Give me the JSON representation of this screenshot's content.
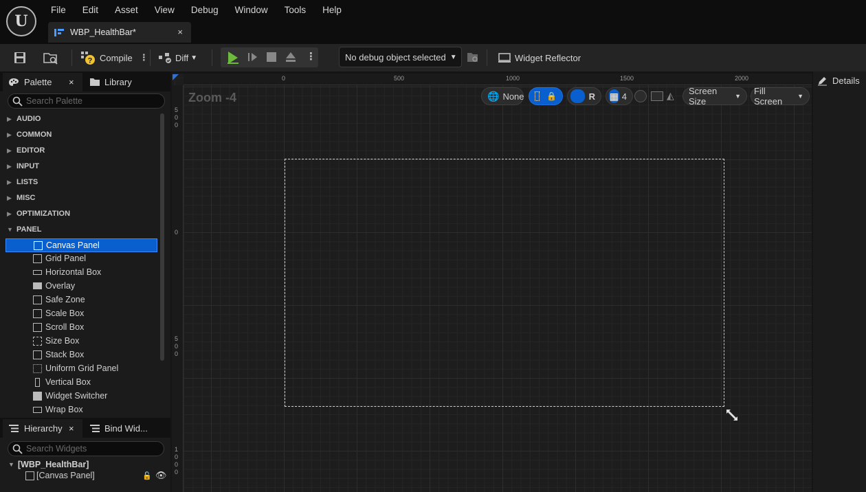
{
  "menu": [
    "File",
    "Edit",
    "Asset",
    "View",
    "Debug",
    "Window",
    "Tools",
    "Help"
  ],
  "document_tab": {
    "title": "WBP_HealthBar*",
    "close": "×"
  },
  "toolbar": {
    "compile_label": "Compile",
    "diff_label": "Diff",
    "debug_select": "No debug object selected",
    "widget_reflector_label": "Widget Reflector"
  },
  "palette": {
    "tab_label": "Palette",
    "close": "×",
    "library_label": "Library",
    "search_placeholder": "Search Palette",
    "categories_collapsed": [
      "AUDIO",
      "COMMON",
      "EDITOR",
      "INPUT",
      "LISTS",
      "MISC",
      "OPTIMIZATION"
    ],
    "category_open": "PANEL",
    "items": [
      "Canvas Panel",
      "Grid Panel",
      "Horizontal Box",
      "Overlay",
      "Safe Zone",
      "Scale Box",
      "Scroll Box",
      "Size Box",
      "Stack Box",
      "Uniform Grid Panel",
      "Vertical Box",
      "Widget Switcher",
      "Wrap Box"
    ],
    "selected_item": "Canvas Panel"
  },
  "hierarchy": {
    "tab_label": "Hierarchy",
    "close": "×",
    "bind_label": "Bind Wid...",
    "search_placeholder": "Search Widgets",
    "root": "[WBP_HealthBar]",
    "child": "[Canvas Panel]"
  },
  "designer": {
    "zoom_label": "Zoom -4",
    "ruler_top": [
      "0",
      "500",
      "1000",
      "1500",
      "2000"
    ],
    "ruler_left": [
      [
        "5",
        "0",
        "0"
      ],
      [
        "0"
      ],
      [
        "5",
        "0",
        "0"
      ],
      [
        "1",
        "0",
        "0",
        "0"
      ]
    ],
    "localization": "None",
    "resize_mode": "R",
    "grid_snap": "4",
    "screen_size": "Screen Size",
    "fill_screen": "Fill Screen"
  },
  "details": {
    "title": "Details"
  }
}
